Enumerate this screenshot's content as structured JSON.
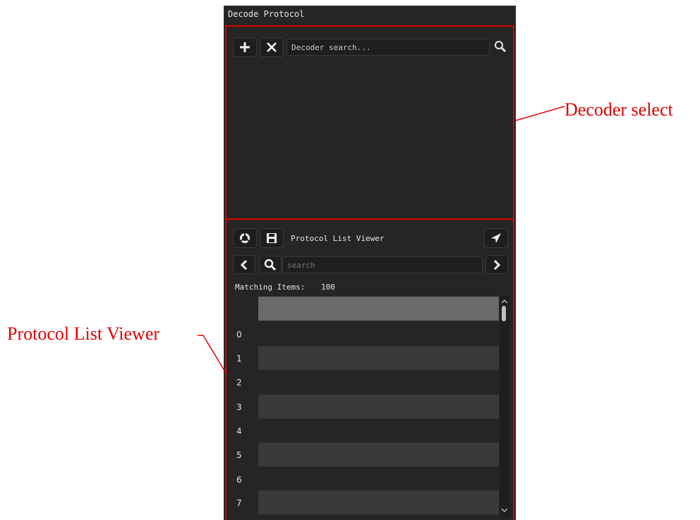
{
  "window": {
    "title": "Decode Protocol"
  },
  "decoder_select": {
    "add_icon": "plus-icon",
    "remove_icon": "close-icon",
    "search_placeholder": "Decoder search...",
    "search_icon": "search-icon"
  },
  "protocol_list": {
    "title": "Protocol List Viewer",
    "set_icon": "settings-wheel-icon",
    "save_icon": "save-icon",
    "locate_icon": "navigate-arrow-icon",
    "prev_icon": "chevron-left-icon",
    "next_icon": "chevron-right-icon",
    "search_placeholder": "search",
    "matching_label": "Matching Items:",
    "matching_count": "100",
    "rows": [
      "0",
      "1",
      "2",
      "3",
      "4",
      "5",
      "6",
      "7"
    ]
  },
  "annotations": {
    "decoder_select": "Decoder select",
    "protocol_list_viewer": "Protocol List Viewer"
  },
  "colors": {
    "panel": "#252525",
    "highlight": "#e00000",
    "row_alt": "#3a3a3a",
    "header_row": "#6a6a6a"
  }
}
